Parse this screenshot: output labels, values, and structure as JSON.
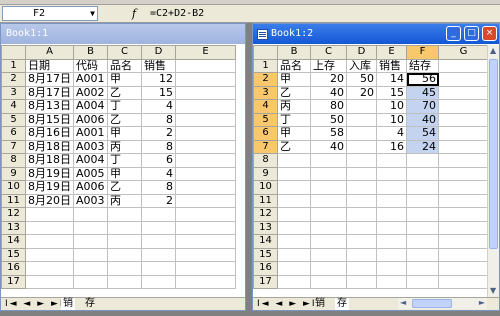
{
  "formula_bar": {
    "name_box": "F2",
    "fx_icon": "fx-icon",
    "formula": "=C2+D2-B2"
  },
  "left_window": {
    "title": "Book1:1",
    "col_headers": [
      "A",
      "B",
      "C",
      "D",
      "E"
    ],
    "rows": [
      {
        "n": "1",
        "cells": [
          "日期",
          "代码",
          "品名",
          "销售",
          ""
        ]
      },
      {
        "n": "2",
        "cells": [
          "8月17日",
          "A001",
          "甲",
          "12",
          ""
        ]
      },
      {
        "n": "3",
        "cells": [
          "8月17日",
          "A002",
          "乙",
          "15",
          ""
        ]
      },
      {
        "n": "4",
        "cells": [
          "8月13日",
          "A004",
          "丁",
          "4",
          ""
        ]
      },
      {
        "n": "5",
        "cells": [
          "8月15日",
          "A006",
          "乙",
          "8",
          ""
        ]
      },
      {
        "n": "6",
        "cells": [
          "8月16日",
          "A001",
          "甲",
          "2",
          ""
        ]
      },
      {
        "n": "7",
        "cells": [
          "8月18日",
          "A003",
          "丙",
          "8",
          ""
        ]
      },
      {
        "n": "8",
        "cells": [
          "8月18日",
          "A004",
          "丁",
          "6",
          ""
        ]
      },
      {
        "n": "9",
        "cells": [
          "8月19日",
          "A005",
          "甲",
          "4",
          ""
        ]
      },
      {
        "n": "10",
        "cells": [
          "8月19日",
          "A006",
          "乙",
          "8",
          ""
        ]
      },
      {
        "n": "11",
        "cells": [
          "8月20日",
          "A003",
          "丙",
          "2",
          ""
        ]
      },
      {
        "n": "12",
        "cells": [
          "",
          "",
          "",
          "",
          ""
        ]
      },
      {
        "n": "13",
        "cells": [
          "",
          "",
          "",
          "",
          ""
        ]
      },
      {
        "n": "14",
        "cells": [
          "",
          "",
          "",
          "",
          ""
        ]
      },
      {
        "n": "15",
        "cells": [
          "",
          "",
          "",
          "",
          ""
        ]
      },
      {
        "n": "16",
        "cells": [
          "",
          "",
          "",
          "",
          ""
        ]
      },
      {
        "n": "17",
        "cells": [
          "",
          "",
          "",
          "",
          ""
        ]
      }
    ],
    "sheet_tabs": {
      "nav": "I◄ ◄ ► ►I",
      "tab1": "销",
      "tab2": "存"
    }
  },
  "right_window": {
    "title": "Book1:2",
    "col_headers": [
      "B",
      "C",
      "D",
      "E",
      "F",
      "G"
    ],
    "rows": [
      {
        "n": "1",
        "cells": [
          "品名",
          "上存",
          "入库",
          "销售",
          "结存",
          ""
        ]
      },
      {
        "n": "2",
        "cells": [
          "甲",
          "20",
          "50",
          "14",
          "56",
          ""
        ]
      },
      {
        "n": "3",
        "cells": [
          "乙",
          "40",
          "20",
          "15",
          "45",
          ""
        ]
      },
      {
        "n": "4",
        "cells": [
          "丙",
          "80",
          "",
          "10",
          "70",
          ""
        ]
      },
      {
        "n": "5",
        "cells": [
          "丁",
          "50",
          "",
          "10",
          "40",
          ""
        ]
      },
      {
        "n": "6",
        "cells": [
          "甲",
          "58",
          "",
          "4",
          "54",
          ""
        ]
      },
      {
        "n": "7",
        "cells": [
          "乙",
          "40",
          "",
          "16",
          "24",
          ""
        ]
      },
      {
        "n": "8",
        "cells": [
          "",
          "",
          "",
          "",
          "",
          ""
        ]
      },
      {
        "n": "9",
        "cells": [
          "",
          "",
          "",
          "",
          "",
          ""
        ]
      },
      {
        "n": "10",
        "cells": [
          "",
          "",
          "",
          "",
          "",
          ""
        ]
      },
      {
        "n": "11",
        "cells": [
          "",
          "",
          "",
          "",
          "",
          ""
        ]
      },
      {
        "n": "12",
        "cells": [
          "",
          "",
          "",
          "",
          "",
          ""
        ]
      },
      {
        "n": "13",
        "cells": [
          "",
          "",
          "",
          "",
          "",
          ""
        ]
      },
      {
        "n": "14",
        "cells": [
          "",
          "",
          "",
          "",
          "",
          ""
        ]
      },
      {
        "n": "15",
        "cells": [
          "",
          "",
          "",
          "",
          "",
          ""
        ]
      },
      {
        "n": "16",
        "cells": [
          "",
          "",
          "",
          "",
          "",
          ""
        ]
      },
      {
        "n": "17",
        "cells": [
          "",
          "",
          "",
          "",
          "",
          ""
        ]
      }
    ],
    "sheet_tabs": {
      "nav": "I◄ ◄ ► ►I",
      "tab1": "销",
      "tab2": "存"
    },
    "window_buttons": {
      "minimize": "_",
      "maximize": "□",
      "close": "×"
    }
  }
}
